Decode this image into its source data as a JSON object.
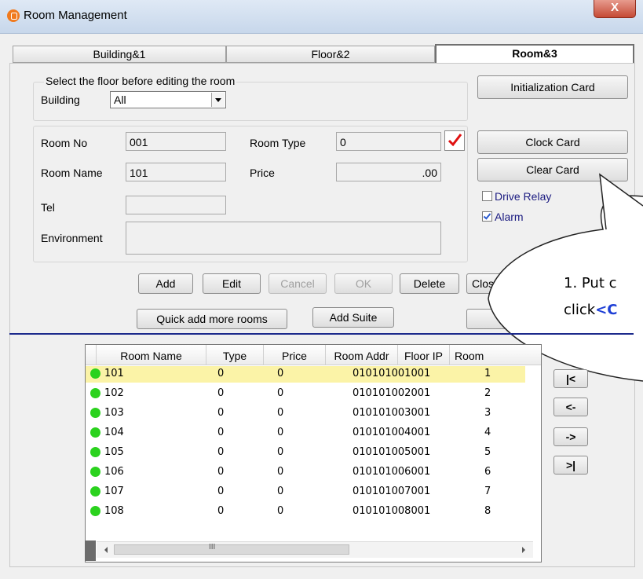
{
  "window": {
    "title": "Room Management",
    "close_label": "X"
  },
  "tabs": [
    {
      "label": "Building&1"
    },
    {
      "label": "Floor&2"
    },
    {
      "label": "Room&3",
      "active": true
    }
  ],
  "floor_section": {
    "hint": "Select the floor before editing the room",
    "building_label": "Building",
    "building_value": "All"
  },
  "form": {
    "room_no_label": "Room No",
    "room_no_value": "001",
    "room_type_label": "Room Type",
    "room_type_value": "0",
    "room_name_label": "Room Name",
    "room_name_value": "101",
    "price_label": "Price",
    "price_value": ".00",
    "tel_label": "Tel",
    "tel_value": "",
    "environment_label": "Environment",
    "environment_value": ""
  },
  "side_buttons": {
    "init_card": "Initialization Card",
    "clock_card": "Clock Card",
    "clear_card": "Clear Card"
  },
  "checkboxes": {
    "drive_relay": {
      "label": "Drive Relay",
      "checked": false
    },
    "alarm": {
      "label": "Alarm",
      "checked": true
    }
  },
  "actions": {
    "add": "Add",
    "edit": "Edit",
    "cancel": "Cancel",
    "ok": "OK",
    "delete": "Delete",
    "close": "Clos",
    "quick_add": "Quick add more rooms",
    "add_suite": "Add Suite"
  },
  "callout": {
    "line1": "1. Put c",
    "line2_prefix": "click",
    "line2_highlight": "<C",
    "highlight_color": "#1e3fd6"
  },
  "table": {
    "headers": [
      "Room Name",
      "Type",
      "Price",
      "Room Addr",
      "Floor IP",
      "Room"
    ],
    "rows": [
      [
        "101",
        "0",
        "0",
        "010101001001",
        "1"
      ],
      [
        "102",
        "0",
        "0",
        "010101002001",
        "2"
      ],
      [
        "103",
        "0",
        "0",
        "010101003001",
        "3"
      ],
      [
        "104",
        "0",
        "0",
        "010101004001",
        "4"
      ],
      [
        "105",
        "0",
        "0",
        "010101005001",
        "5"
      ],
      [
        "106",
        "0",
        "0",
        "010101006001",
        "6"
      ],
      [
        "107",
        "0",
        "0",
        "010101007001",
        "7"
      ],
      [
        "108",
        "0",
        "0",
        "010101008001",
        "8"
      ]
    ],
    "selected_row": 0,
    "hscroll_grip": "III"
  },
  "nav": {
    "first": "|<",
    "prev": "<-",
    "next": "->",
    "last": ">|"
  }
}
